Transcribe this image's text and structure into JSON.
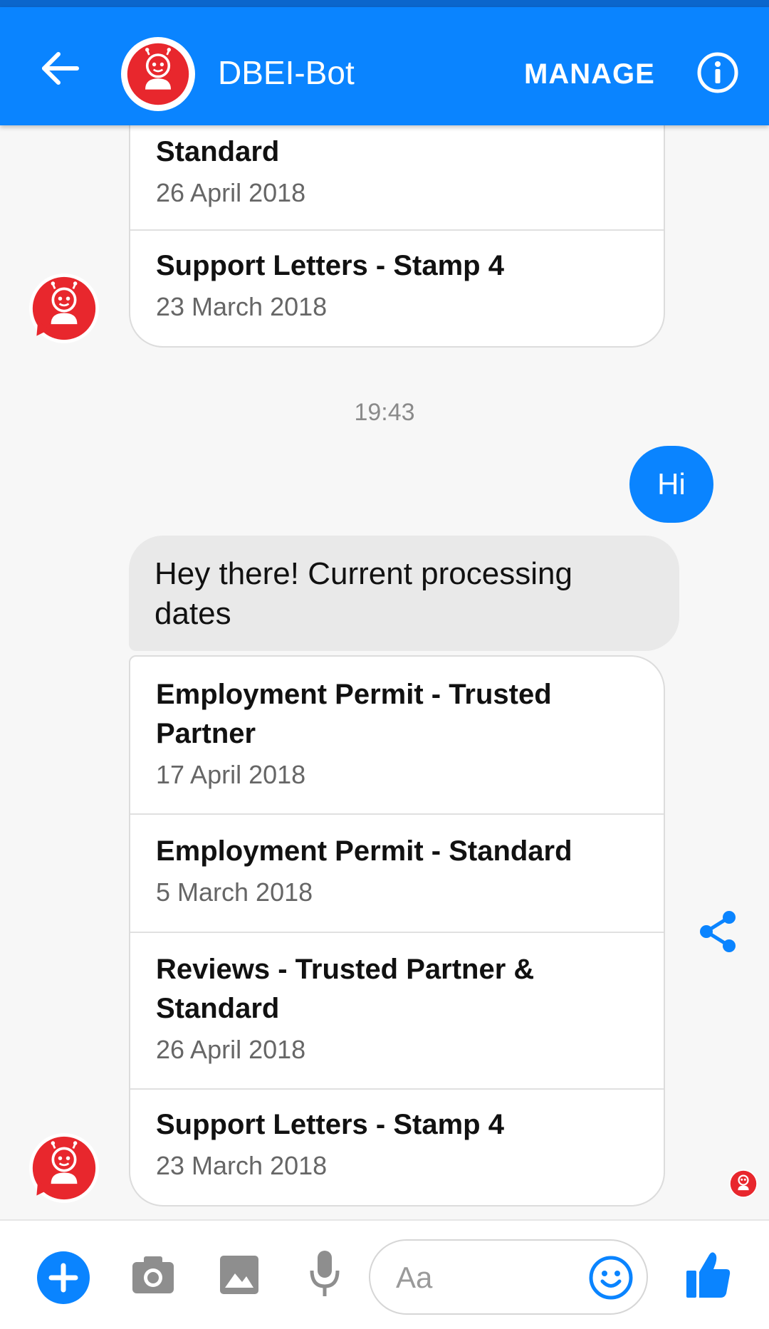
{
  "header": {
    "title": "DBEI-Bot",
    "manage_label": "MANAGE",
    "icons": [
      "back-arrow-icon",
      "bot-avatar",
      "info-icon"
    ],
    "colors": {
      "bar": "#0a84ff",
      "bot_avatar": "#e8272d"
    }
  },
  "conversation": {
    "earlier_card": {
      "items": [
        {
          "title": "Standard",
          "date": "26 April 2018"
        },
        {
          "title": "Support Letters - Stamp 4",
          "date": "23 March 2018"
        }
      ]
    },
    "timestamp": "19:43",
    "user_message": "Hi",
    "bot_message": "Hey there! Current processing dates",
    "latest_card": {
      "items": [
        {
          "title": "Employment Permit - Trusted Partner",
          "date": "17 April 2018"
        },
        {
          "title": "Employment Permit - Standard",
          "date": "5 March 2018"
        },
        {
          "title": "Reviews - Trusted Partner & Standard",
          "date": "26 April 2018"
        },
        {
          "title": "Support Letters - Stamp 4",
          "date": "23 March 2018"
        }
      ]
    }
  },
  "composer": {
    "placeholder": "Aa",
    "icons": [
      "plus-icon",
      "camera-icon",
      "image-icon",
      "microphone-icon",
      "smiley-icon",
      "thumbs-up-icon"
    ]
  }
}
